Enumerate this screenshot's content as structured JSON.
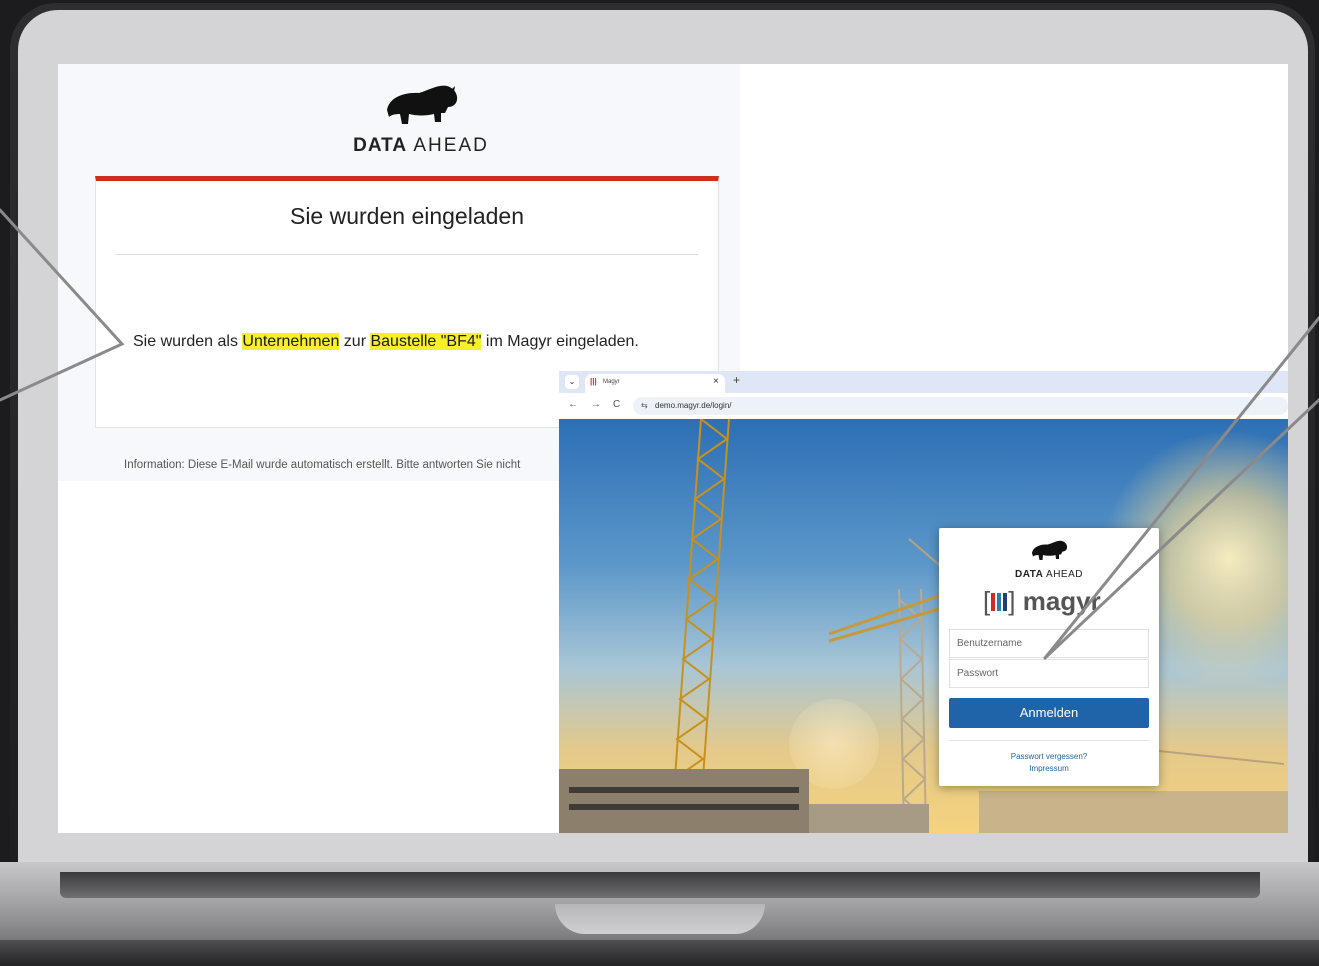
{
  "email": {
    "logo": {
      "bold": "DATA",
      "light": "AHEAD"
    },
    "title": "Sie wurden eingeladen",
    "message": {
      "part1": "Sie wurden als ",
      "highlight1": "Unternehmen",
      "part2": " zur ",
      "highlight2": "Baustelle \"BF4\"",
      "part3": " im Magyr eingeladen."
    },
    "info": "Information: Diese E-Mail wurde automatisch erstellt. Bitte antworten Sie nicht"
  },
  "browser": {
    "tab_title": "Magyr",
    "tab_close": "×",
    "new_tab": "+",
    "tab_menu": "⌄",
    "url": "demo.magyr.de/login/",
    "nav": {
      "back": "←",
      "forward": "→",
      "reload": "C"
    }
  },
  "login": {
    "logo": {
      "bold": "DATA",
      "light": "AHEAD"
    },
    "brand": "magyr",
    "username_placeholder": "Benutzername",
    "password_placeholder": "Passwort",
    "submit": "Anmelden",
    "forgot_link": "Passwort vergessen?",
    "imprint_link": "Impressum"
  },
  "colors": {
    "accent_red": "#d42a25",
    "highlight_yellow": "#f6f02a",
    "button_blue": "#1f63a8"
  }
}
